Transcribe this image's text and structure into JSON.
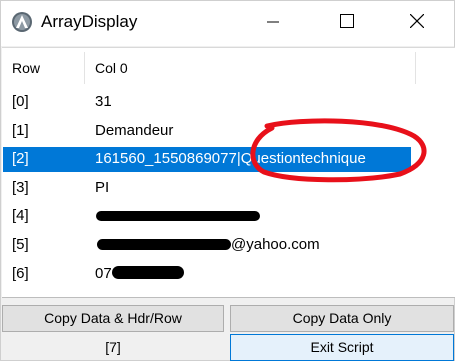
{
  "window": {
    "title": "ArrayDisplay",
    "app_icon": "autoit-icon",
    "controls": [
      "minimize-icon",
      "maximize-icon",
      "close-icon"
    ]
  },
  "listview": {
    "columns": [
      "Row",
      "Col 0"
    ],
    "rows": [
      {
        "index": "[0]",
        "value": "31"
      },
      {
        "index": "[1]",
        "value": "Demandeur"
      },
      {
        "index": "[2]",
        "value": "161560_1550869077|Questiontechnique",
        "selected": true
      },
      {
        "index": "[3]",
        "value": "PI"
      },
      {
        "index": "[4]",
        "value": ""
      },
      {
        "index": "[5]",
        "value": "@yahoo.com"
      },
      {
        "index": "[6]",
        "value": "07"
      }
    ]
  },
  "buttons": {
    "copy_hdr": "Copy Data & Hdr/Row",
    "copy_data": "Copy Data Only",
    "exit": "Exit Script"
  },
  "status": {
    "count": "[7]"
  },
  "colors": {
    "selection": "#0078d7",
    "annotation": "#e8101a"
  }
}
